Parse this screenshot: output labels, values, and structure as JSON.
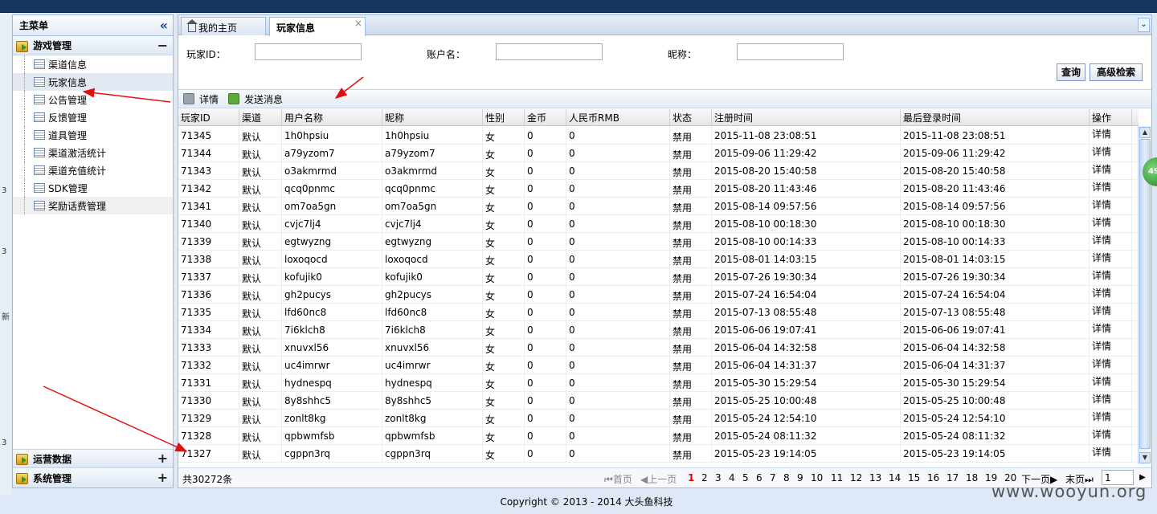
{
  "sidebar": {
    "title": "主菜单",
    "collapse_icon": "«",
    "sections": [
      {
        "label": "游戏管理",
        "sign": "−",
        "items": [
          "渠道信息",
          "玩家信息",
          "公告管理",
          "反馈管理",
          "道具管理",
          "渠道激活统计",
          "渠道充值统计",
          "SDK管理",
          "奖励话费管理"
        ]
      },
      {
        "label": "运营数据",
        "sign": "+"
      },
      {
        "label": "系统管理",
        "sign": "+"
      }
    ]
  },
  "tabs": [
    {
      "label": "我的主页"
    },
    {
      "label": "玩家信息",
      "close": "×"
    }
  ],
  "tab_scroll": "⌄",
  "form": {
    "player_id_label": "玩家ID：",
    "account_label": "账户名：",
    "nickname_label": "昵称：",
    "player_id": "",
    "account": "",
    "nickname": "",
    "search": "查询",
    "advanced": "高级检索"
  },
  "toolbar": {
    "detail": "详情",
    "send": "发送消息"
  },
  "columns": [
    "玩家ID",
    "渠道",
    "用户名称",
    "昵称",
    "性别",
    "金币",
    "人民币RMB",
    "状态",
    "注册时间",
    "最后登录时间",
    "操作"
  ],
  "rows": [
    [
      "71345",
      "默认",
      "1h0hpsiu",
      "1h0hpsiu",
      "女",
      "0",
      "0",
      "禁用",
      "2015-11-08 23:08:51",
      "2015-11-08 23:08:51",
      "详情"
    ],
    [
      "71344",
      "默认",
      "a79yzom7",
      "a79yzom7",
      "女",
      "0",
      "0",
      "禁用",
      "2015-09-06 11:29:42",
      "2015-09-06 11:29:42",
      "详情"
    ],
    [
      "71343",
      "默认",
      "o3akmrmd",
      "o3akmrmd",
      "女",
      "0",
      "0",
      "禁用",
      "2015-08-20 15:40:58",
      "2015-08-20 15:40:58",
      "详情"
    ],
    [
      "71342",
      "默认",
      "qcq0pnmc",
      "qcq0pnmc",
      "女",
      "0",
      "0",
      "禁用",
      "2015-08-20 11:43:46",
      "2015-08-20 11:43:46",
      "详情"
    ],
    [
      "71341",
      "默认",
      "om7oa5gn",
      "om7oa5gn",
      "女",
      "0",
      "0",
      "禁用",
      "2015-08-14 09:57:56",
      "2015-08-14 09:57:56",
      "详情"
    ],
    [
      "71340",
      "默认",
      "cvjc7lj4",
      "cvjc7lj4",
      "女",
      "0",
      "0",
      "禁用",
      "2015-08-10 00:18:30",
      "2015-08-10 00:18:30",
      "详情"
    ],
    [
      "71339",
      "默认",
      "egtwyzng",
      "egtwyzng",
      "女",
      "0",
      "0",
      "禁用",
      "2015-08-10 00:14:33",
      "2015-08-10 00:14:33",
      "详情"
    ],
    [
      "71338",
      "默认",
      "loxoqocd",
      "loxoqocd",
      "女",
      "0",
      "0",
      "禁用",
      "2015-08-01 14:03:15",
      "2015-08-01 14:03:15",
      "详情"
    ],
    [
      "71337",
      "默认",
      "kofujik0",
      "kofujik0",
      "女",
      "0",
      "0",
      "禁用",
      "2015-07-26 19:30:34",
      "2015-07-26 19:30:34",
      "详情"
    ],
    [
      "71336",
      "默认",
      "gh2pucys",
      "gh2pucys",
      "女",
      "0",
      "0",
      "禁用",
      "2015-07-24 16:54:04",
      "2015-07-24 16:54:04",
      "详情"
    ],
    [
      "71335",
      "默认",
      "lfd60nc8",
      "lfd60nc8",
      "女",
      "0",
      "0",
      "禁用",
      "2015-07-13 08:55:48",
      "2015-07-13 08:55:48",
      "详情"
    ],
    [
      "71334",
      "默认",
      "7i6klch8",
      "7i6klch8",
      "女",
      "0",
      "0",
      "禁用",
      "2015-06-06 19:07:41",
      "2015-06-06 19:07:41",
      "详情"
    ],
    [
      "71333",
      "默认",
      "xnuvxl56",
      "xnuvxl56",
      "女",
      "0",
      "0",
      "禁用",
      "2015-06-04 14:32:58",
      "2015-06-04 14:32:58",
      "详情"
    ],
    [
      "71332",
      "默认",
      "uc4imrwr",
      "uc4imrwr",
      "女",
      "0",
      "0",
      "禁用",
      "2015-06-04 14:31:37",
      "2015-06-04 14:31:37",
      "详情"
    ],
    [
      "71331",
      "默认",
      "hydnespq",
      "hydnespq",
      "女",
      "0",
      "0",
      "禁用",
      "2015-05-30 15:29:54",
      "2015-05-30 15:29:54",
      "详情"
    ],
    [
      "71330",
      "默认",
      "8y8shhc5",
      "8y8shhc5",
      "女",
      "0",
      "0",
      "禁用",
      "2015-05-25 10:00:48",
      "2015-05-25 10:00:48",
      "详情"
    ],
    [
      "71329",
      "默认",
      "zonlt8kg",
      "zonlt8kg",
      "女",
      "0",
      "0",
      "禁用",
      "2015-05-24 12:54:10",
      "2015-05-24 12:54:10",
      "详情"
    ],
    [
      "71328",
      "默认",
      "qpbwmfsb",
      "qpbwmfsb",
      "女",
      "0",
      "0",
      "禁用",
      "2015-05-24 08:11:32",
      "2015-05-24 08:11:32",
      "详情"
    ],
    [
      "71327",
      "默认",
      "cgppn3rq",
      "cgppn3rq",
      "女",
      "0",
      "0",
      "禁用",
      "2015-05-23 19:14:05",
      "2015-05-23 19:14:05",
      "详情"
    ]
  ],
  "pager": {
    "total": "共30272条",
    "first": "首页",
    "prev": "上一页",
    "pages": [
      "1",
      "2",
      "3",
      "4",
      "5",
      "6",
      "7",
      "8",
      "9",
      "10",
      "11",
      "12",
      "13",
      "14",
      "15",
      "16",
      "17",
      "18",
      "19",
      "20"
    ],
    "next": "下一页",
    "last": "末页",
    "page_input": "1"
  },
  "footer": "Copyright © 2013 - 2014 大头鱼科技",
  "watermark": "www.wooyun.org",
  "badge": "49",
  "left_strip": [
    "3",
    "3",
    "新",
    "3"
  ],
  "colors": {
    "annotation_arrow": "#e01010",
    "accent": "#99bbe8",
    "current_page": "#e00000"
  }
}
